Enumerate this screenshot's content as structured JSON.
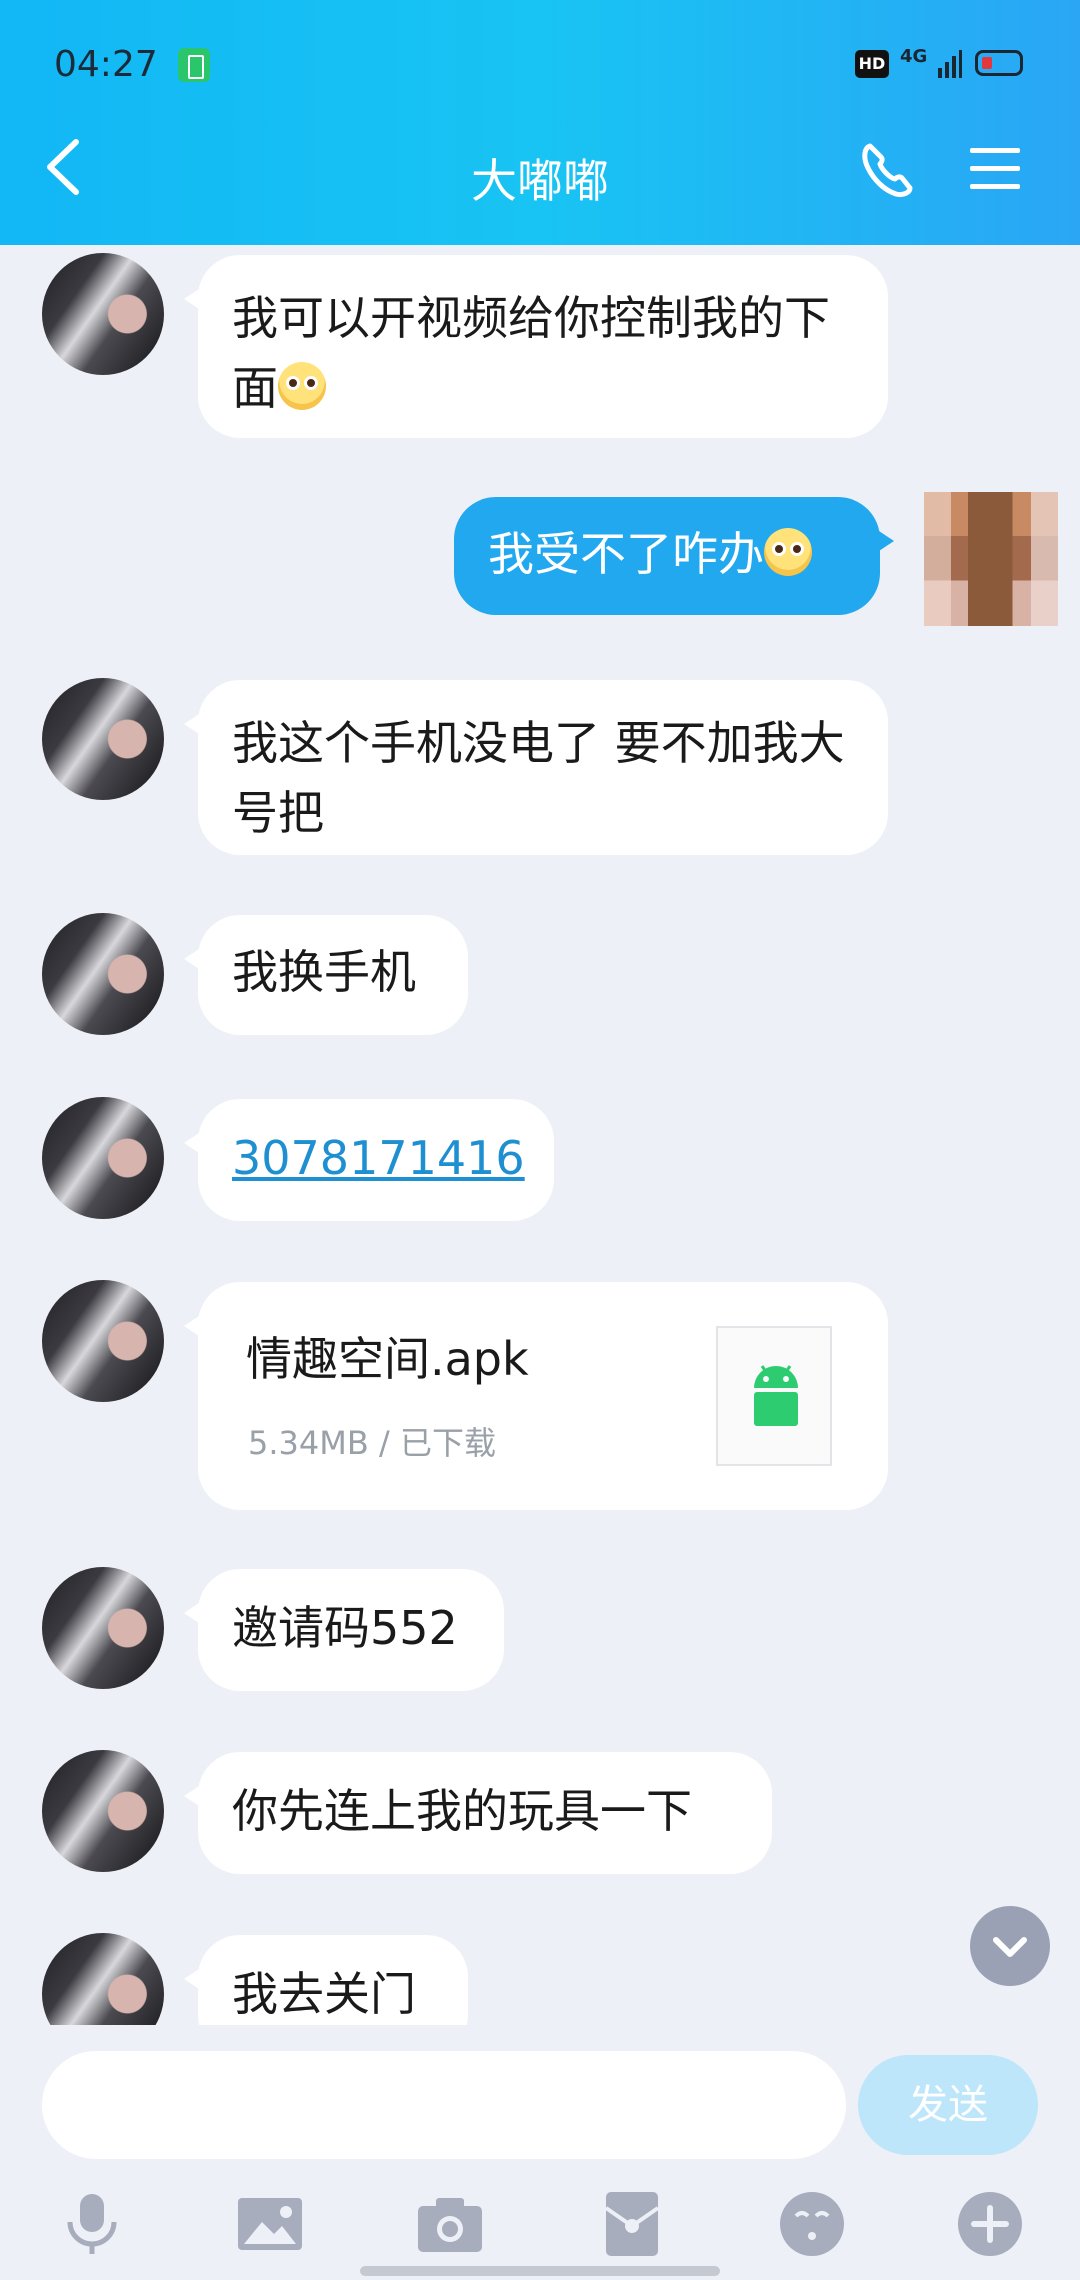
{
  "status_bar": {
    "time": "04:27",
    "hd": "HD",
    "network": "4G"
  },
  "header": {
    "title": "大嘟嘟",
    "back_icon": "chevron-left-icon",
    "call_icon": "phone-icon",
    "menu_icon": "menu-icon"
  },
  "messages": [
    {
      "side": "left",
      "text": "我可以开视频给你控制我的下面"
    },
    {
      "side": "right",
      "text": "我受不了咋办"
    },
    {
      "side": "left",
      "text": "我这个手机没电了  要不加我大号把"
    },
    {
      "side": "left",
      "text": "我换手机"
    },
    {
      "side": "left",
      "type": "link",
      "text": "3078171416"
    },
    {
      "side": "left",
      "type": "file",
      "file_name": "情趣空间.apk",
      "file_meta": "5.34MB / 已下载"
    },
    {
      "side": "left",
      "text": "邀请码552"
    },
    {
      "side": "left",
      "text": "你先连上我的玩具一下"
    },
    {
      "side": "left",
      "text": "我去关门"
    }
  ],
  "composer": {
    "input_value": "",
    "send_label": "发送"
  },
  "toolbar_icons": [
    "microphone-icon",
    "image-icon",
    "camera-icon",
    "red-packet-icon",
    "emoji-icon",
    "plus-icon"
  ],
  "colors": {
    "header": "#12b7f5",
    "sent_bubble": "#22a8ef",
    "background": "#edf0f7",
    "send_button_disabled": "#bde6fb"
  }
}
